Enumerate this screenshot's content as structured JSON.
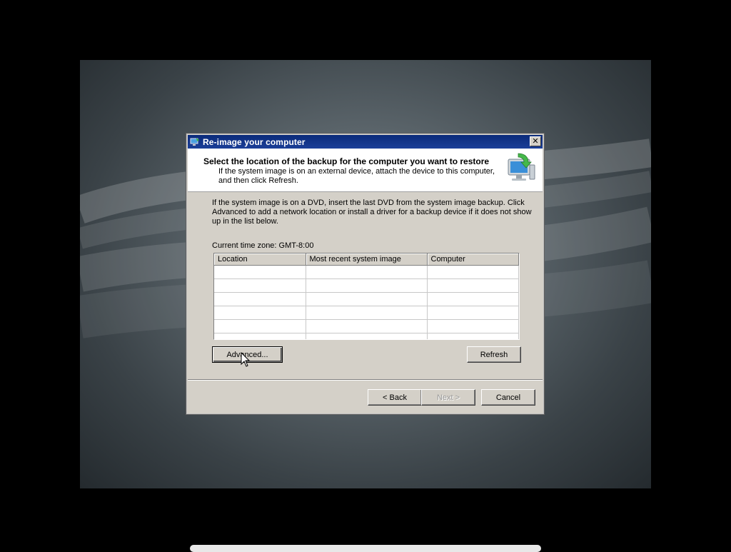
{
  "window": {
    "title": "Re-image your computer",
    "close_label": "✕"
  },
  "header": {
    "title": "Select the location of the backup for the computer you want to restore",
    "subtitle": "If the system image is on an external device, attach the device to this computer, and then click Refresh."
  },
  "body": {
    "instructions": "If the system image is on a DVD, insert the last DVD from the system image backup. Click Advanced to add a network location or install a driver for a backup device if it does not show up in the list below.",
    "timezone": "Current time zone: GMT-8:00"
  },
  "table": {
    "columns": [
      "Location",
      "Most recent system image",
      "Computer"
    ],
    "rows": []
  },
  "buttons": {
    "advanced": "Advanced...",
    "refresh": "Refresh",
    "back": "< Back",
    "next": "Next >",
    "cancel": "Cancel"
  },
  "colors": {
    "titlebar": "#0a2a7a",
    "dialog_bg": "#d4d0c8"
  },
  "icons": {
    "title": "reimage-app-icon",
    "header": "computer-restore-icon",
    "cursor": "mouse-pointer-icon"
  }
}
